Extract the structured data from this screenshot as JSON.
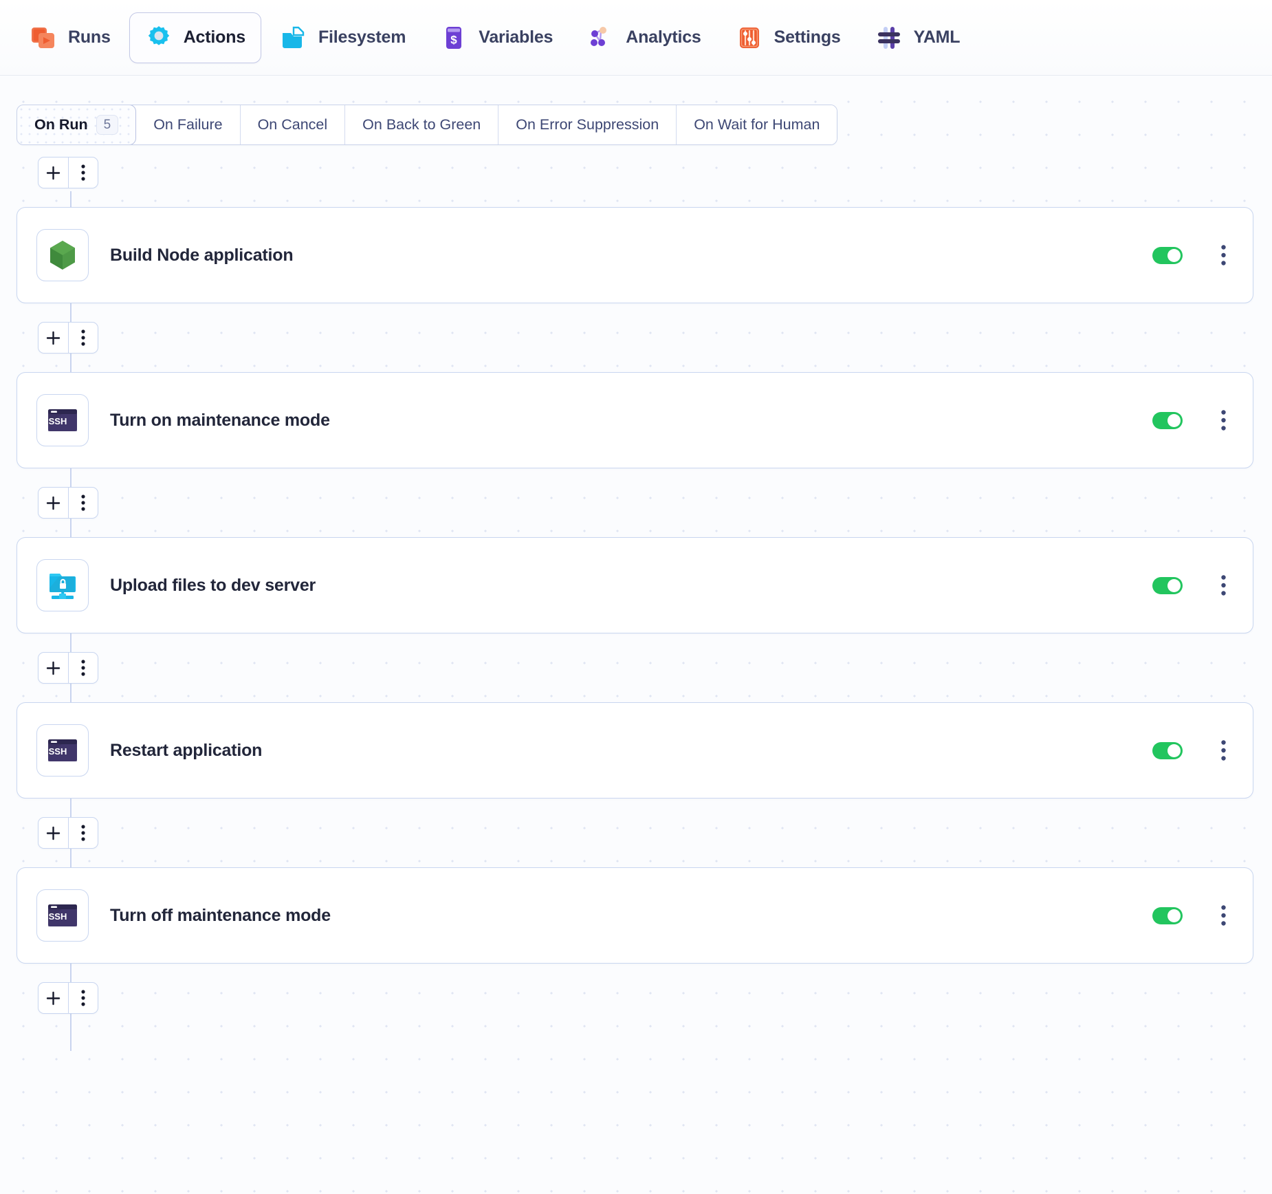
{
  "nav": {
    "items": [
      {
        "label": "Runs",
        "icon": "runs-icon",
        "active": false
      },
      {
        "label": "Actions",
        "icon": "gear-icon",
        "active": true
      },
      {
        "label": "Filesystem",
        "icon": "folder-icon",
        "active": false
      },
      {
        "label": "Variables",
        "icon": "variables-icon",
        "active": false
      },
      {
        "label": "Analytics",
        "icon": "analytics-icon",
        "active": false
      },
      {
        "label": "Settings",
        "icon": "sliders-icon",
        "active": false
      },
      {
        "label": "YAML",
        "icon": "yaml-icon",
        "active": false
      }
    ]
  },
  "tabs": {
    "items": [
      {
        "label": "On Run",
        "count": "5",
        "active": true
      },
      {
        "label": "On Failure",
        "count": "",
        "active": false
      },
      {
        "label": "On Cancel",
        "count": "",
        "active": false
      },
      {
        "label": "On Back to Green",
        "count": "",
        "active": false
      },
      {
        "label": "On Error Suppression",
        "count": "",
        "active": false
      },
      {
        "label": "On Wait for Human",
        "count": "",
        "active": false
      }
    ]
  },
  "add_button": {
    "plus_label": "+",
    "menu_label": "⋮"
  },
  "actions": [
    {
      "title": "Build Node application",
      "icon": "node-icon",
      "enabled": true
    },
    {
      "title": "Turn on maintenance mode",
      "icon": "ssh-icon",
      "enabled": true
    },
    {
      "title": "Upload files to dev server",
      "icon": "sftp-icon",
      "enabled": true
    },
    {
      "title": "Restart application",
      "icon": "ssh-icon",
      "enabled": true
    },
    {
      "title": "Turn off maintenance mode",
      "icon": "ssh-icon",
      "enabled": true
    }
  ],
  "colors": {
    "toggle_on": "#22c55e",
    "card_border": "#c9d6f0",
    "node_green": "#4e9a47",
    "ssh_purple": "#3b3260",
    "sftp_cyan": "#18b7e8",
    "accent_orange": "#ef5d30",
    "accent_purple": "#6d3fd4"
  }
}
